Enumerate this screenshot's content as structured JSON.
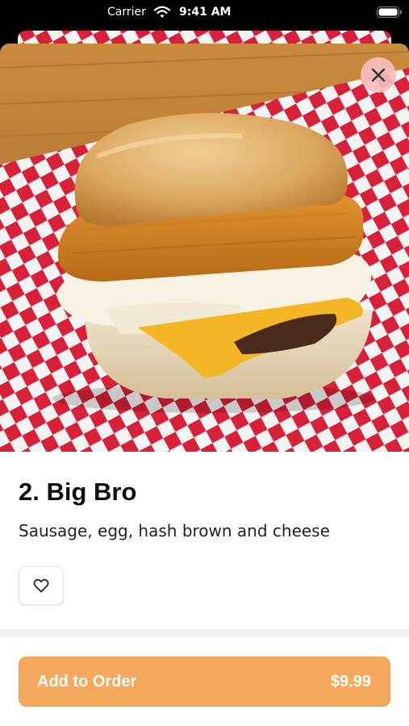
{
  "status_bar": {
    "carrier": "Carrier",
    "time": "9:41 AM"
  },
  "hero": {
    "icon": "breakfast-sandwich-photo"
  },
  "close": {
    "icon": "close-icon"
  },
  "item": {
    "title": "2. Big Bro",
    "description": "Sausage, egg, hash brown and cheese"
  },
  "favorite": {
    "icon": "heart-icon"
  },
  "order": {
    "label": "Add to Order",
    "price": "$9.99",
    "accent": "#f5a95c"
  }
}
